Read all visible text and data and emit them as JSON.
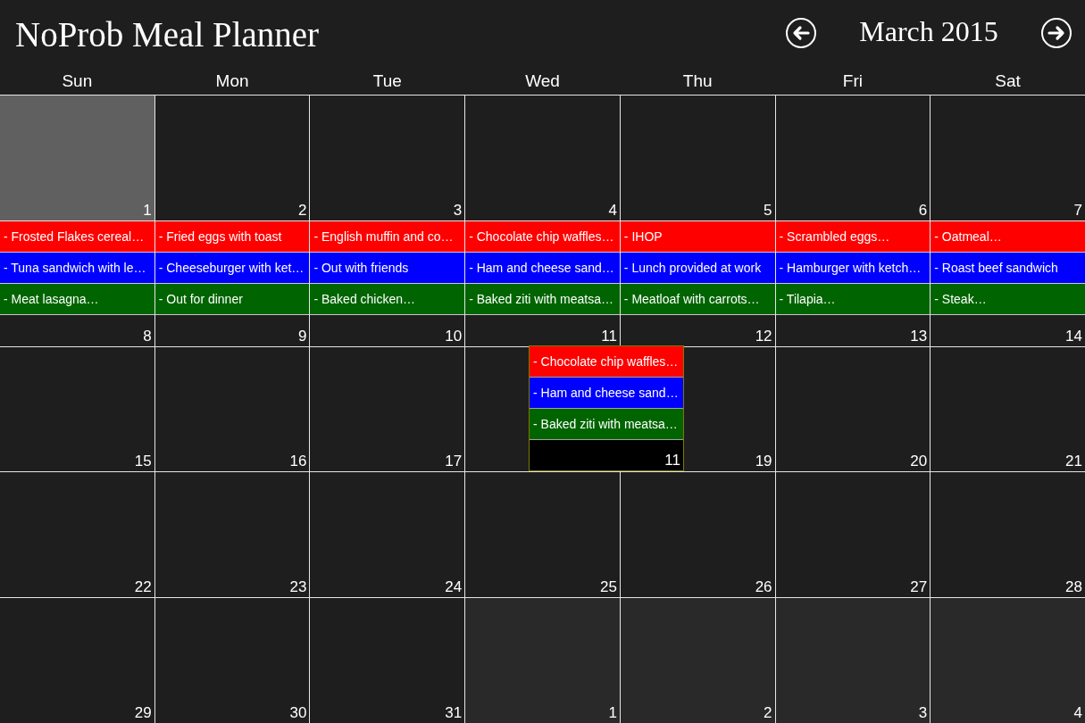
{
  "app": {
    "title": "NoProb Meal Planner"
  },
  "nav": {
    "month": "March 2015"
  },
  "weekdays": [
    "Sun",
    "Mon",
    "Tue",
    "Wed",
    "Thu",
    "Fri",
    "Sat"
  ],
  "weeks": [
    {
      "days": [
        {
          "day": "1",
          "selected": true,
          "kind": "current"
        },
        {
          "day": "2",
          "selected": false,
          "kind": "current"
        },
        {
          "day": "3",
          "selected": false,
          "kind": "current"
        },
        {
          "day": "4",
          "selected": false,
          "kind": "current"
        },
        {
          "day": "5",
          "selected": false,
          "kind": "current"
        },
        {
          "day": "6",
          "selected": false,
          "kind": "current"
        },
        {
          "day": "7",
          "selected": false,
          "kind": "current"
        }
      ]
    },
    {
      "days": [
        {
          "day": "8",
          "selected": false,
          "kind": "current",
          "meals": [
            {
              "text": "- Frosted Flakes cereal…",
              "color": "#ff0000"
            },
            {
              "text": "- Tuna sandwich with le…",
              "color": "#0000ff"
            },
            {
              "text": "- Meat lasagna…",
              "color": "#006400"
            }
          ]
        },
        {
          "day": "9",
          "selected": false,
          "kind": "current",
          "meals": [
            {
              "text": "- Fried eggs with toast",
              "color": "#ff0000"
            },
            {
              "text": "- Cheeseburger with ket…",
              "color": "#0000ff"
            },
            {
              "text": "- Out for dinner",
              "color": "#006400"
            }
          ]
        },
        {
          "day": "10",
          "selected": false,
          "kind": "current",
          "meals": [
            {
              "text": "- English muffin and co…",
              "color": "#ff0000"
            },
            {
              "text": "- Out with friends",
              "color": "#0000ff"
            },
            {
              "text": "- Baked chicken…",
              "color": "#006400"
            }
          ]
        },
        {
          "day": "11",
          "selected": false,
          "kind": "current",
          "meals": [
            {
              "text": "- Chocolate chip waffles…",
              "color": "#ff0000"
            },
            {
              "text": "- Ham and cheese sand…",
              "color": "#0000ff"
            },
            {
              "text": "- Baked ziti with meatsa…",
              "color": "#006400"
            }
          ]
        },
        {
          "day": "12",
          "selected": false,
          "kind": "current",
          "meals": [
            {
              "text": "- IHOP",
              "color": "#ff0000"
            },
            {
              "text": "- Lunch provided at work",
              "color": "#0000ff"
            },
            {
              "text": "- Meatloaf with carrots…",
              "color": "#006400"
            }
          ]
        },
        {
          "day": "13",
          "selected": false,
          "kind": "current",
          "meals": [
            {
              "text": "- Scrambled eggs…",
              "color": "#ff0000"
            },
            {
              "text": "- Hamburger with ketch…",
              "color": "#0000ff"
            },
            {
              "text": "- Tilapia…",
              "color": "#006400"
            }
          ]
        },
        {
          "day": "14",
          "selected": false,
          "kind": "current",
          "meals": [
            {
              "text": "- Oatmeal…",
              "color": "#ff0000"
            },
            {
              "text": "- Roast beef sandwich",
              "color": "#0000ff"
            },
            {
              "text": "- Steak…",
              "color": "#006400"
            }
          ]
        }
      ]
    },
    {
      "days": [
        {
          "day": "15",
          "selected": false,
          "kind": "current"
        },
        {
          "day": "16",
          "selected": false,
          "kind": "current"
        },
        {
          "day": "17",
          "selected": false,
          "kind": "current"
        },
        {
          "selected": false,
          "kind": "current"
        },
        {
          "day": "19",
          "selected": false,
          "kind": "current"
        },
        {
          "day": "20",
          "selected": false,
          "kind": "current"
        },
        {
          "day": "21",
          "selected": false,
          "kind": "current"
        }
      ]
    },
    {
      "days": [
        {
          "day": "22",
          "selected": false,
          "kind": "current"
        },
        {
          "day": "23",
          "selected": false,
          "kind": "current"
        },
        {
          "day": "24",
          "selected": false,
          "kind": "current"
        },
        {
          "day": "25",
          "selected": false,
          "kind": "current"
        },
        {
          "day": "26",
          "selected": false,
          "kind": "current"
        },
        {
          "day": "27",
          "selected": false,
          "kind": "current"
        },
        {
          "day": "28",
          "selected": false,
          "kind": "current"
        }
      ]
    },
    {
      "days": [
        {
          "day": "29",
          "selected": false,
          "kind": "current"
        },
        {
          "day": "30",
          "selected": false,
          "kind": "current"
        },
        {
          "day": "31",
          "selected": false,
          "kind": "current"
        },
        {
          "day": "1",
          "selected": false,
          "kind": "adjacent"
        },
        {
          "day": "2",
          "selected": false,
          "kind": "adjacent"
        },
        {
          "day": "3",
          "selected": false,
          "kind": "adjacent"
        },
        {
          "day": "4",
          "selected": false,
          "kind": "adjacent"
        }
      ]
    }
  ],
  "popup": {
    "day": "11",
    "meals": [
      {
        "text": "- Chocolate chip waffles…",
        "color": "#ff0000"
      },
      {
        "text": "- Ham and cheese sand…",
        "color": "#0000ff"
      },
      {
        "text": "- Baked ziti with meatsa…",
        "color": "#006400"
      }
    ]
  }
}
